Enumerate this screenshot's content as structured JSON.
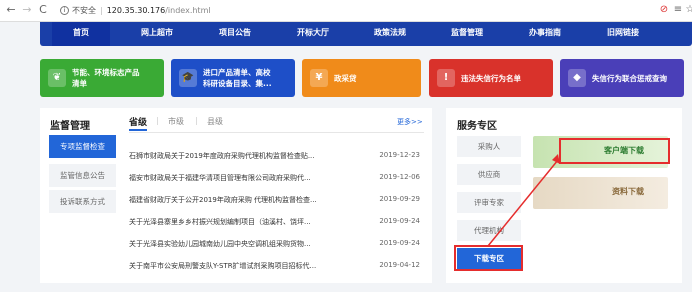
{
  "browser": {
    "back_icon": "←",
    "forward_icon": "→",
    "reload_icon": "C",
    "info_icon": "i",
    "security_label": "不安全",
    "separator": "|",
    "url_host": "120.35.30.176",
    "url_path": "/index.html",
    "ext_icon": "⊘",
    "menu_icon": "≡",
    "star_icon": "☆"
  },
  "nav": {
    "items": [
      "首页",
      "网上超市",
      "项目公告",
      "开标大厅",
      "政策法规",
      "监督管理",
      "办事指南",
      "旧网链接"
    ]
  },
  "tiles": [
    {
      "line1": "节能、环境标志产品",
      "line2": "清单",
      "color": "#3aaa35",
      "icon": "❦"
    },
    {
      "line1": "进口产品清单、高校",
      "line2": "科研设备目录、集...",
      "color": "#1e4fc8",
      "icon": "🎓"
    },
    {
      "line1": "政采贷",
      "line2": "",
      "color": "#f08b1a",
      "icon": "¥"
    },
    {
      "line1": "违法失信行为名单",
      "line2": "",
      "color": "#d9322b",
      "icon": "!"
    },
    {
      "line1": "失信行为联合惩戒查询",
      "line2": "",
      "color": "#4a3fb8",
      "icon": "◆"
    }
  ],
  "supervision": {
    "title": "监督管理",
    "side_buttons": [
      "专项监督检查",
      "监管信息公告",
      "投诉联系方式"
    ],
    "tabs": [
      "省级",
      "市级",
      "县级"
    ],
    "tab_sep": "|",
    "more": "更多>>",
    "news": [
      {
        "title": "石狮市财政局关于2019年度政府采购代理机构监督检查贴...",
        "date": "2019-12-23"
      },
      {
        "title": "福安市财政局关于福建华清项目管理有限公司政府采购代...",
        "date": "2019-12-06"
      },
      {
        "title": "福建省财政厅关于公开2019年政府采购 代理机构监督检查...",
        "date": "2019-09-29"
      },
      {
        "title": "关于光泽县寨里乡乡村振兴规划编制项目（油溪村、饶坪...",
        "date": "2019-09-24"
      },
      {
        "title": "关于光泽县实验幼儿园城南幼儿园中央空调机组采购货物...",
        "date": "2019-09-24"
      },
      {
        "title": "关于南平市公安局刑警支队Y-STR扩增试剂采购项目招标代...",
        "date": "2019-04-12"
      }
    ]
  },
  "service": {
    "title": "服务专区",
    "side_buttons": [
      "采购人",
      "供应商",
      "评审专家",
      "代理机构",
      "下载专区"
    ],
    "client_download": "客户端下载",
    "material_download": "资料下载"
  },
  "colors": {
    "nav_bg": "#1a3fa8",
    "accent": "#2266d8",
    "highlight_red": "#e52d2d"
  }
}
